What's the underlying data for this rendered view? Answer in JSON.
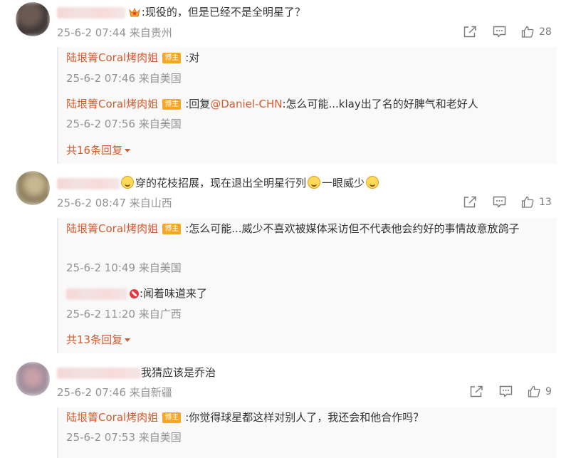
{
  "comments": [
    {
      "text": ":现役的，但是已经不是全明星了？",
      "time": "25-6-2 07:44",
      "location": "来自贵州",
      "like_count": "28",
      "replies": [
        {
          "author": "陆垠箐Coral烤肉姐",
          "badge": "博主",
          "text": ":对",
          "time": "25-6-2 07:46",
          "location": "来自美国"
        },
        {
          "author": "陆垠箐Coral烤肉姐",
          "badge": "博主",
          "prefix": ":回复",
          "mention": "@Daniel-CHN",
          "text": ":怎么可能...klay出了名的好脾气和老好人",
          "time": "25-6-2 07:56",
          "location": "来自美国"
        }
      ],
      "more_replies": "共16条回复"
    },
    {
      "text_a": "穿的花枝招展，现在退出全明星行列",
      "text_b": "一眼威少",
      "time": "25-6-2 08:47",
      "location": "来自山西",
      "like_count": "13",
      "replies": [
        {
          "author": "陆垠箐Coral烤肉姐",
          "badge": "博主",
          "text": ":怎么可能...威少不喜欢被媒体采访但不代表他会约好的事情故意放鸽子",
          "time": "25-6-2 10:49",
          "location": "来自美国"
        },
        {
          "text": ":闻着味道来了",
          "time": "25-6-2 11:20",
          "location": "来自广西"
        }
      ],
      "more_replies": "共13条回复"
    },
    {
      "text": "我猜应该是乔治",
      "time": "25-6-2 07:46",
      "location": "来自新疆",
      "like_count": "9",
      "replies": [
        {
          "author": "陆垠箐Coral烤肉姐",
          "badge": "博主",
          "text": ":你觉得球星都这样对别人了，我还会和他合作吗？",
          "time": "25-6-2 07:53",
          "location": "来自美国"
        }
      ]
    }
  ],
  "icons": {
    "share": "share-icon",
    "comment": "comment-icon",
    "like": "like-icon",
    "emoji": "cat-face-emoji-icon",
    "crown": "crown-badge-icon",
    "red_badge": "red-badge-icon"
  },
  "colors": {
    "author": "#d25b2e",
    "meta": "#939393",
    "badge": "#f5a623",
    "reply_bg": "#f9f9f9"
  }
}
